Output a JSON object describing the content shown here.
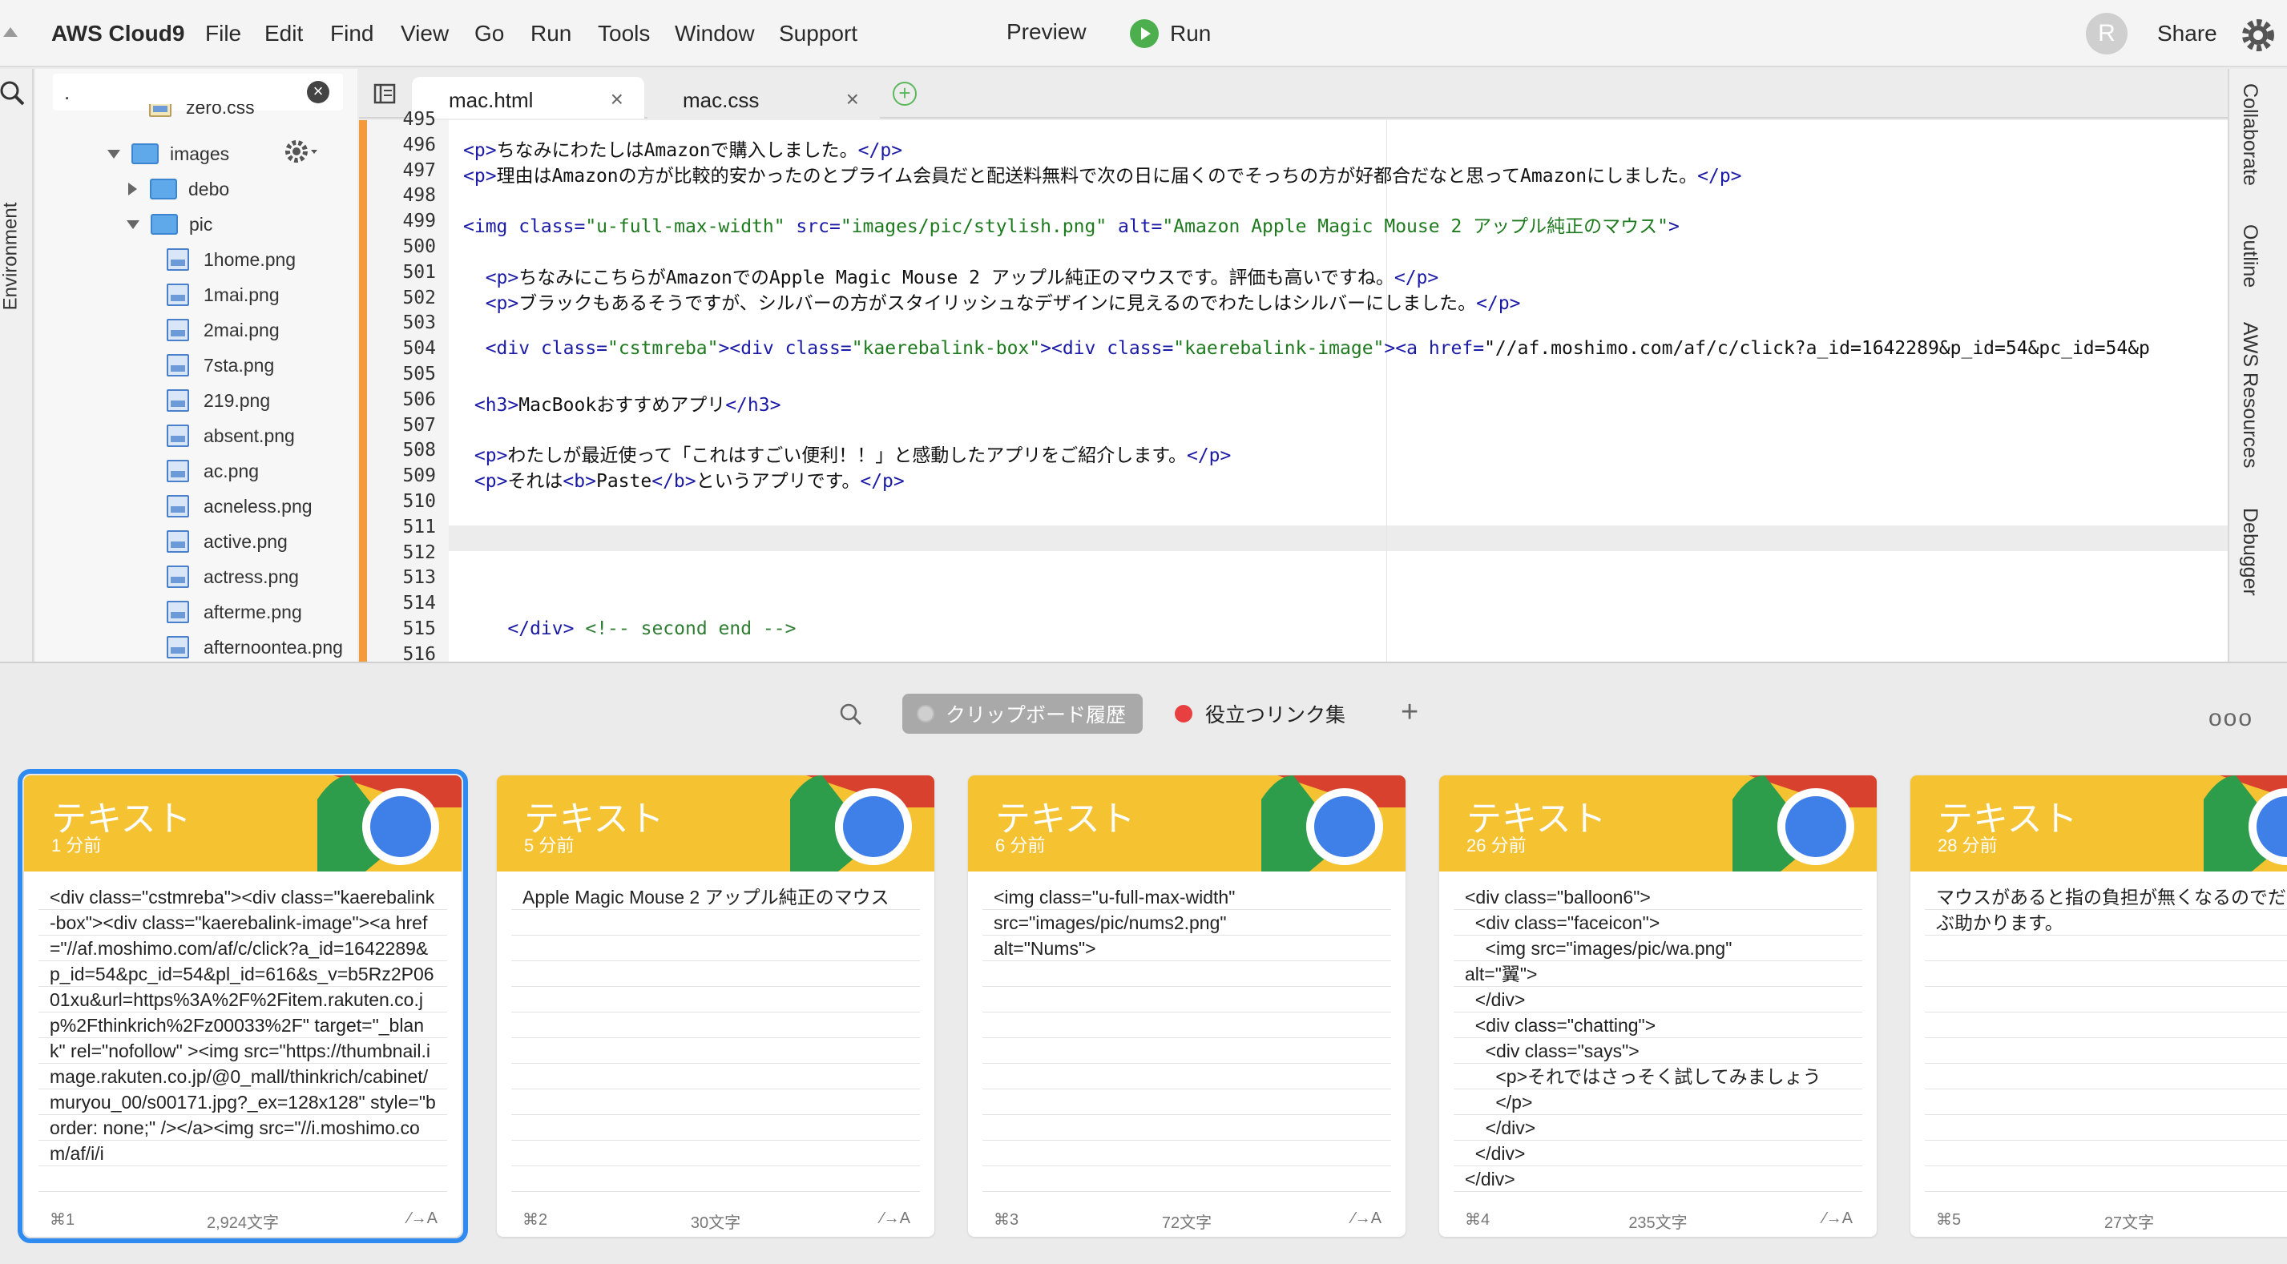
{
  "menubar": {
    "brand": "AWS Cloud9",
    "menus": [
      "File",
      "Edit",
      "Find",
      "View",
      "Go",
      "Run",
      "Tools",
      "Window",
      "Support"
    ],
    "preview": "Preview",
    "run": "Run",
    "avatar_letter": "R",
    "share": "Share"
  },
  "sidebar": {
    "environment_label": "Environment",
    "search_value": ".",
    "tree": [
      {
        "label": "zero.css",
        "kind": "file"
      },
      {
        "label": "images",
        "kind": "folder-open"
      },
      {
        "label": "debo",
        "kind": "folder-closed"
      },
      {
        "label": "pic",
        "kind": "folder-open"
      },
      {
        "label": "1home.png",
        "kind": "file"
      },
      {
        "label": "1mai.png",
        "kind": "file"
      },
      {
        "label": "2mai.png",
        "kind": "file"
      },
      {
        "label": "7sta.png",
        "kind": "file"
      },
      {
        "label": "219.png",
        "kind": "file"
      },
      {
        "label": "absent.png",
        "kind": "file"
      },
      {
        "label": "ac.png",
        "kind": "file"
      },
      {
        "label": "acneless.png",
        "kind": "file"
      },
      {
        "label": "active.png",
        "kind": "file"
      },
      {
        "label": "actress.png",
        "kind": "file"
      },
      {
        "label": "afterme.png",
        "kind": "file"
      },
      {
        "label": "afternoontea.png",
        "kind": "file"
      }
    ]
  },
  "tabs": [
    {
      "label": "mac.html",
      "active": true
    },
    {
      "label": "mac.css",
      "active": false
    }
  ],
  "editor": {
    "lines": [
      {
        "n": "495",
        "text": ""
      },
      {
        "n": "496",
        "text": "<p>ちなみにわたしはAmazonで購入しました。</p>"
      },
      {
        "n": "497",
        "text": "<p>理由はAmazonの方が比較的安かったのとプライム会員だと配送料無料で次の日に届くのでそっちの方が好都合だなと思ってAmazonにしました。</p>"
      },
      {
        "n": "498",
        "text": ""
      },
      {
        "n": "499",
        "text": "<img class=\"u-full-max-width\" src=\"images/pic/stylish.png\" alt=\"Amazon Apple Magic Mouse 2 アップル純正のマウス\">"
      },
      {
        "n": "500",
        "text": ""
      },
      {
        "n": "501",
        "text": "  <p>ちなみにこちらがAmazonでのApple Magic Mouse 2 アップル純正のマウスです。評価も高いですね。</p>"
      },
      {
        "n": "502",
        "text": "  <p>ブラックもあるそうですが、シルバーの方がスタイリッシュなデザインに見えるのでわたしはシルバーにしました。</p>"
      },
      {
        "n": "503",
        "text": ""
      },
      {
        "n": "504",
        "text": "  <div class=\"cstmreba\"><div class=\"kaerebalink-box\"><div class=\"kaerebalink-image\"><a href=\"//af.moshimo.com/af/c/click?a_id=1642289&p_id=54&pc_id=54&p"
      },
      {
        "n": "505",
        "text": ""
      },
      {
        "n": "506",
        "text": " <h3>MacBookおすすめアプリ</h3>"
      },
      {
        "n": "507",
        "text": ""
      },
      {
        "n": "508",
        "text": " <p>わたしが最近使って「これはすごい便利！！」と感動したアプリをご紹介します。</p>"
      },
      {
        "n": "509",
        "text": " <p>それは<b>Paste</b>というアプリです。</p>"
      },
      {
        "n": "510",
        "text": ""
      },
      {
        "n": "511",
        "text": ""
      },
      {
        "n": "512",
        "text": ""
      },
      {
        "n": "513",
        "text": ""
      },
      {
        "n": "514",
        "text": ""
      },
      {
        "n": "515",
        "text": "    </div> <!-- second end -->"
      },
      {
        "n": "516",
        "text": ""
      }
    ]
  },
  "right_panels": [
    "Collaborate",
    "Outline",
    "AWS Resources",
    "Debugger"
  ],
  "clipboard": {
    "pinboards": [
      {
        "label": "クリップボード履歴",
        "selected": true
      },
      {
        "label": "役立つリンク集",
        "selected": false,
        "color": "#e84040"
      }
    ],
    "add": "+",
    "more": "ooo",
    "cards": [
      {
        "type": "テキスト",
        "time": "1 分前",
        "shortcut": "⌘1",
        "count": "2,924文字",
        "text": "<div class=\"cstmreba\"><div class=\"kaerebalink-box\"><div class=\"kaerebalink-image\"><a href=\"//af.moshimo.com/af/c/click?a_id=1642289&p_id=54&pc_id=54&pl_id=616&s_v=b5Rz2P0601xu&url=https%3A%2F%2Fitem.rakuten.co.jp%2Fthinkrich%2Fz00033%2F\" target=\"_blank\" rel=\"nofollow\" ><img src=\"https://thumbnail.image.rakuten.co.jp/@0_mall/thinkrich/cabinet/muryou_00/s00171.jpg?_ex=128x128\" style=\"border: none;\" /></a><img src=\"//i.moshimo.com/af/i/i",
        "selected": true
      },
      {
        "type": "テキスト",
        "time": "5 分前",
        "shortcut": "⌘2",
        "count": "30文字",
        "text": "Apple Magic Mouse 2 アップル純正のマウス",
        "selected": false
      },
      {
        "type": "テキスト",
        "time": "6 分前",
        "shortcut": "⌘3",
        "count": "72文字",
        "text": "<img class=\"u-full-max-width\"\nsrc=\"images/pic/nums2.png\"\nalt=\"Nums\">",
        "selected": false
      },
      {
        "type": "テキスト",
        "time": "26 分前",
        "shortcut": "⌘4",
        "count": "235文字",
        "text": "<div class=\"balloon6\">\n  <div class=\"faceicon\">\n    <img src=\"images/pic/wa.png\"\nalt=\"翼\">\n  </div>\n  <div class=\"chatting\">\n    <div class=\"says\">\n      <p>それではさっそく試してみましょう\n      </p>\n    </div>\n  </div>\n</div>",
        "selected": false
      },
      {
        "type": "テキスト",
        "time": "28 分前",
        "shortcut": "⌘5",
        "count": "27文字",
        "text": "マウスがあると指の負担が無くなるのでだいぶ助かります。",
        "selected": false
      }
    ]
  },
  "colors": {
    "accent_blue": "#2f8bf0",
    "card_header": "#f5c232",
    "run_green": "#4cae4c",
    "gutter_orange": "#f39b3c"
  }
}
